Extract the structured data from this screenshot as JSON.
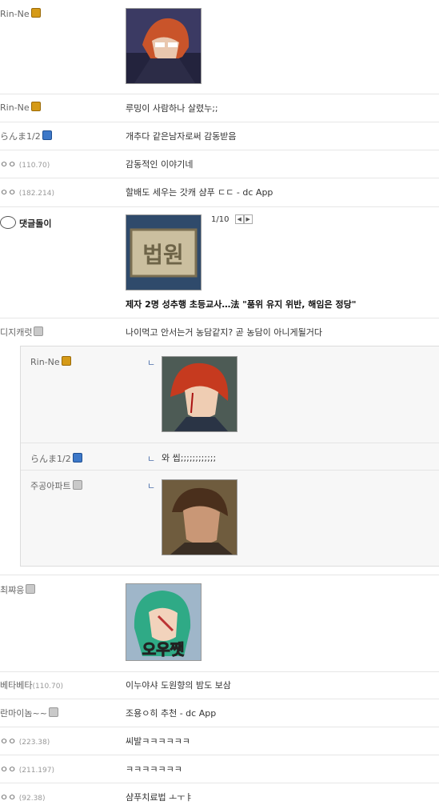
{
  "comments": [
    {
      "nick": "Rin-Ne",
      "icon": "gold"
    },
    {
      "nick": "Rin-Ne",
      "icon": "gold",
      "text": "루밍이 사람하나 살렸누;;"
    },
    {
      "nick": "らんま1/2",
      "icon": "blue",
      "text": "개추다 같은남자로써 감동받음"
    },
    {
      "nick": "ㅇㅇ",
      "ip": "(110.70)",
      "text": "감동적인 이야기네"
    },
    {
      "nick": "ㅇㅇ",
      "ip": "(182.214)",
      "text": "할배도 세우는 갓캐 샴푸 ㄷㄷ - dc App"
    },
    {
      "nick": "댓글돌이",
      "bot": true,
      "pager": "1/10",
      "headline": "제자 2명 성추행 초등교사…法 \"품위 유지 위반, 해임은 정당\"",
      "thumb_text": "법원"
    },
    {
      "nick": "디지캐럿",
      "icon": "gray",
      "text": "나이먹고 안서는거 농담같지? 곧 농담이 아니게될거다"
    },
    {
      "nick": "최쨔응",
      "icon": "gray",
      "thumb_text": "오우쨋"
    },
    {
      "nick": "베타베타",
      "ip": "(110.70)",
      "text": "이누야샤 도원향의 밤도 보삼"
    },
    {
      "nick": "란마이놈~~",
      "icon": "gray",
      "text": "조용ㅇ히 추천 - dc App"
    },
    {
      "nick": "ㅇㅇ",
      "ip": "(223.38)",
      "text": "씨발ㅋㅋㅋㅋㅋㅋ"
    },
    {
      "nick": "ㅇㅇ",
      "ip": "(211.197)",
      "text": "ㅋㅋㅋㅋㅋㅋㅋ"
    },
    {
      "nick": "ㅇㅇ",
      "ip": "(92.38)",
      "text": "샴푸치료법 ㅗㅜㅑ"
    }
  ],
  "replies": [
    {
      "nick": "Rin-Ne",
      "icon": "gold",
      "arrow": "ㄴ"
    },
    {
      "nick": "らんま1/2",
      "icon": "blue",
      "arrow": "ㄴ",
      "text": "와 씹;;;;;;;;;;;;"
    },
    {
      "nick": "주공아파트",
      "icon": "gray",
      "arrow": "ㄴ"
    }
  ]
}
